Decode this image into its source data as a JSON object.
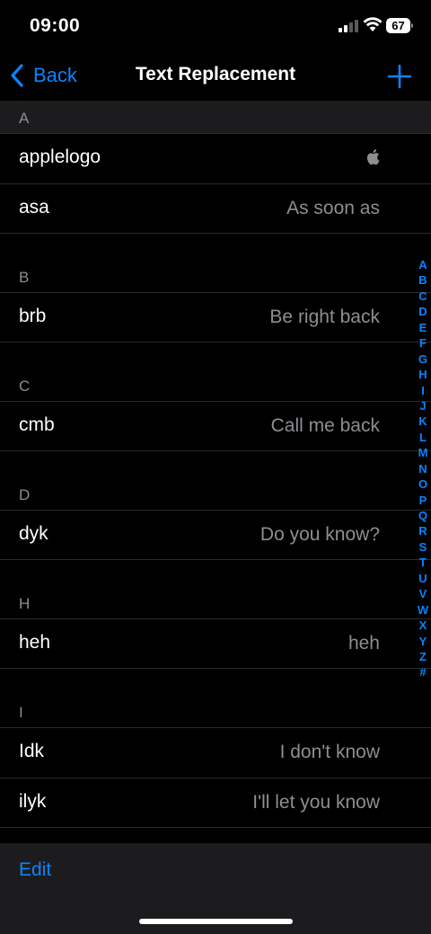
{
  "status": {
    "time": "09:00",
    "battery": "67"
  },
  "nav": {
    "back_label": "Back",
    "title": "Text Replacement"
  },
  "sections": [
    {
      "letter": "A",
      "rows": [
        {
          "shortcut": "applelogo",
          "phrase": "",
          "icon": "apple-logo-icon"
        },
        {
          "shortcut": "asa",
          "phrase": "As soon as"
        }
      ]
    },
    {
      "letter": "B",
      "rows": [
        {
          "shortcut": "brb",
          "phrase": "Be right back"
        }
      ]
    },
    {
      "letter": "C",
      "rows": [
        {
          "shortcut": "cmb",
          "phrase": "Call me back"
        }
      ]
    },
    {
      "letter": "D",
      "rows": [
        {
          "shortcut": "dyk",
          "phrase": "Do you know?"
        }
      ]
    },
    {
      "letter": "H",
      "rows": [
        {
          "shortcut": "heh",
          "phrase": "heh"
        }
      ]
    },
    {
      "letter": "I",
      "rows": [
        {
          "shortcut": "Idk",
          "phrase": "I don't know"
        },
        {
          "shortcut": "ilyk",
          "phrase": "I'll let you know"
        }
      ]
    }
  ],
  "index": [
    "A",
    "B",
    "C",
    "D",
    "E",
    "F",
    "G",
    "H",
    "I",
    "J",
    "K",
    "L",
    "M",
    "N",
    "O",
    "P",
    "Q",
    "R",
    "S",
    "T",
    "U",
    "V",
    "W",
    "X",
    "Y",
    "Z",
    "#"
  ],
  "toolbar": {
    "edit_label": "Edit"
  },
  "colors": {
    "accent": "#0a84ff",
    "secondary_text": "#8d8d93",
    "toolbar_bg": "#1c1c1e"
  }
}
